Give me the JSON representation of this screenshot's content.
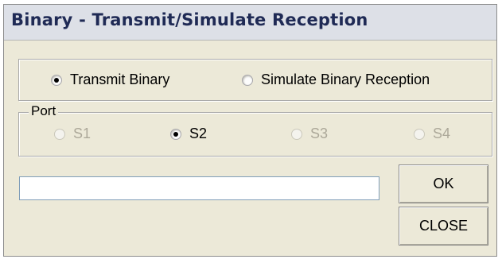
{
  "window": {
    "title": "Binary - Transmit/Simulate Reception"
  },
  "mode": {
    "options": [
      {
        "label": "Transmit Binary",
        "selected": true
      },
      {
        "label": "Simulate Binary Reception",
        "selected": false
      }
    ]
  },
  "port": {
    "legend": "Port",
    "options": [
      {
        "label": "S1",
        "selected": false,
        "enabled": false
      },
      {
        "label": "S2",
        "selected": true,
        "enabled": true
      },
      {
        "label": "S3",
        "selected": false,
        "enabled": false
      },
      {
        "label": "S4",
        "selected": false,
        "enabled": false
      }
    ]
  },
  "input": {
    "value": ""
  },
  "buttons": {
    "ok_label": "OK",
    "close_label": "CLOSE"
  }
}
